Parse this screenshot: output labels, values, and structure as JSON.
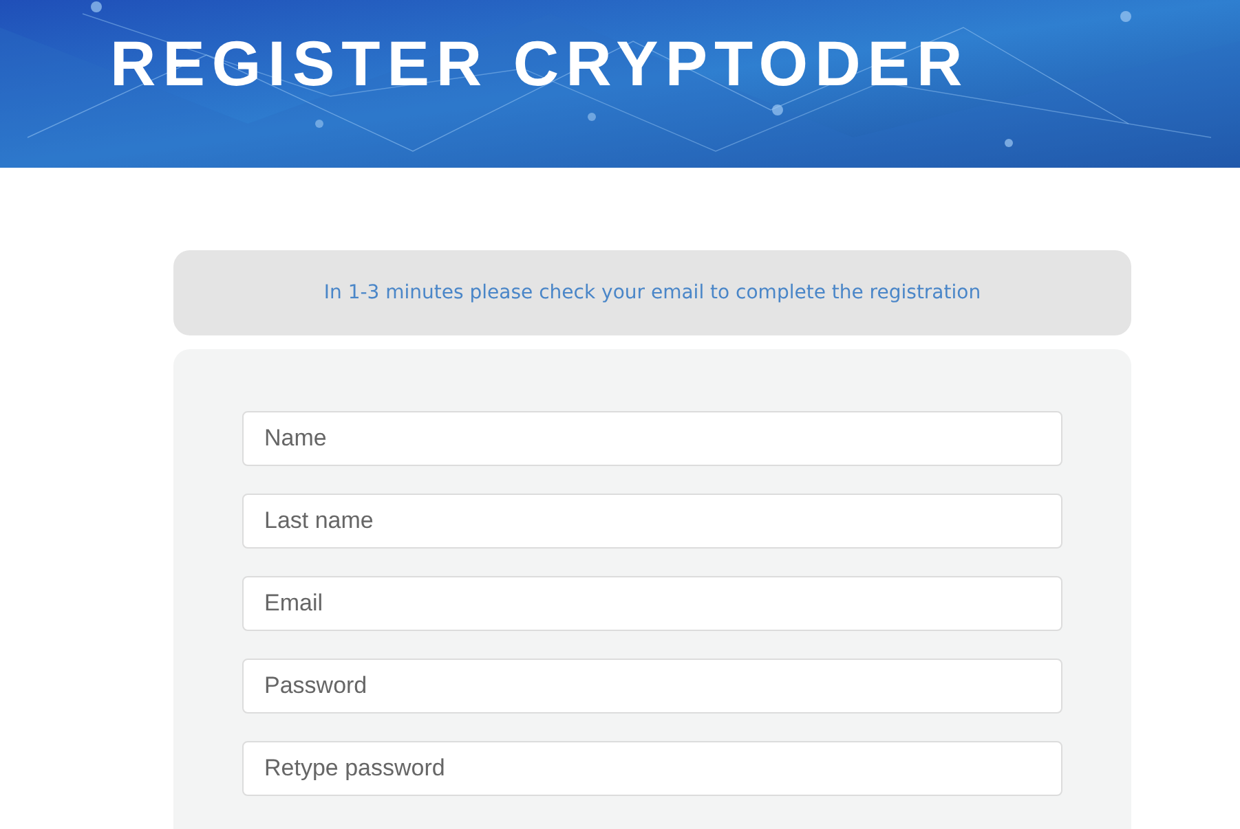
{
  "header": {
    "title": "REGISTER CRYPTODER"
  },
  "notice": {
    "text": "In 1-3 minutes please check your email to complete the registration"
  },
  "form": {
    "fields": [
      {
        "placeholder": "Name"
      },
      {
        "placeholder": "Last name"
      },
      {
        "placeholder": "Email"
      },
      {
        "placeholder": "Password"
      },
      {
        "placeholder": "Retype password"
      }
    ]
  }
}
